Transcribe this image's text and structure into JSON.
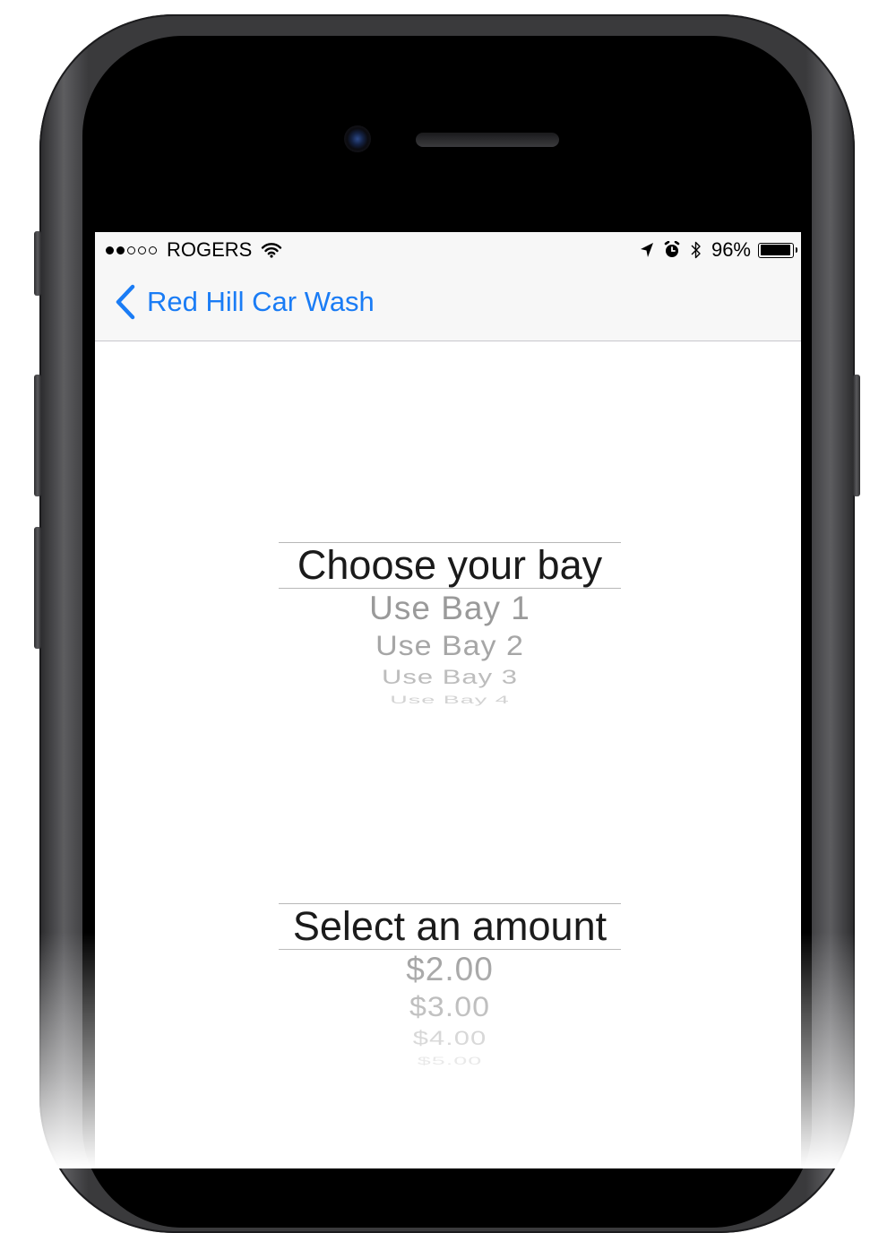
{
  "status_bar": {
    "carrier": "ROGERS",
    "signal_filled": 2,
    "signal_total": 5,
    "battery_percent": "96%",
    "battery_level": 0.96,
    "icons": [
      "wifi-icon",
      "location-arrow-icon",
      "alarm-icon",
      "bluetooth-icon",
      "battery-icon"
    ]
  },
  "nav": {
    "back_label": "Red Hill Car Wash",
    "back_icon": "chevron-left-icon",
    "accent_color": "#1a7cf5"
  },
  "bay_picker": {
    "title": "Choose your bay",
    "options": [
      "Use Bay 1",
      "Use Bay 2",
      "Use Bay 3",
      "Use Bay 4"
    ]
  },
  "amount_picker": {
    "title": "Select an amount",
    "options": [
      "$2.00",
      "$3.00",
      "$4.00",
      "$5.00"
    ]
  }
}
